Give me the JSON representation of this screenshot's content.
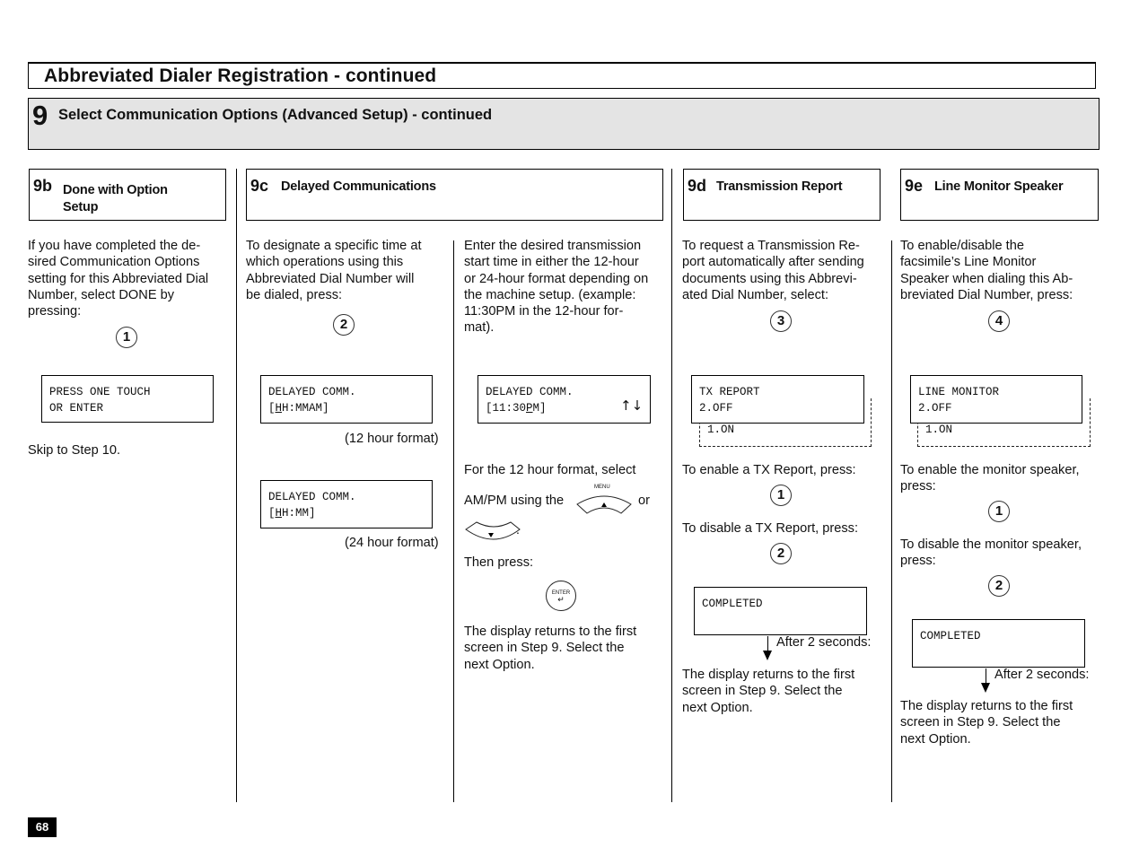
{
  "page_title": "Abbreviated Dialer Registration - continued",
  "step": {
    "number": "9",
    "title": "Select Communication Options (Advanced Setup) - continued"
  },
  "sections": {
    "s9b": {
      "num": "9b",
      "title_line1": "Done with Option",
      "title_line2": "Setup",
      "body": [
        "If you have completed the de-",
        "sired Communication Options",
        "setting for this Abbreviated Dial",
        "Number, select DONE by",
        "pressing:"
      ],
      "key": "1",
      "lcd": [
        "PRESS ONE TOUCH",
        "OR ENTER"
      ],
      "after": "Skip to Step 10."
    },
    "s9c": {
      "num": "9c",
      "title": "Delayed Communications",
      "body": [
        "To designate a specific time at",
        "which operations using this",
        "Abbreviated Dial Number will",
        "be dialed, press:"
      ],
      "key": "2",
      "lcd12": {
        "line1": "DELAYED COMM.",
        "line2_pre": "[",
        "line2_u": "H",
        "line2_post": "H:MMAM]"
      },
      "caption12": "(12 hour format)",
      "lcd24": {
        "line1": "DELAYED COMM.",
        "line2_pre": "[",
        "line2_u": "H",
        "line2_post": "H:MM]"
      },
      "caption24": "(24 hour format)",
      "body2": [
        "Enter the desired transmission",
        "start time in either the 12-hour",
        "or 24-hour format depending on",
        "the machine setup. (example:",
        "11:30PM in the 12-hour for-",
        "mat)."
      ],
      "lcd_example": {
        "line1": "DELAYED COMM.",
        "line2_pre": "[11:30",
        "line2_u": "P",
        "line2_post": "M]",
        "arrows": "↑↓"
      },
      "ampm_line1": "For the 12 hour format, select",
      "ampm_line2_pre": "AM/PM using the",
      "ampm_or": "or",
      "menu_label": "MENU",
      "then_press": "Then press:",
      "enter_label": "ENTER",
      "returns": [
        "The display returns to the first",
        "screen in Step 9. Select the",
        "next Option."
      ]
    },
    "s9d": {
      "num": "9d",
      "title": "Transmission Report",
      "body": [
        "To request a Transmission Re-",
        "port automatically after sending",
        "documents using this Abbrevi-",
        "ated Dial Number, select:"
      ],
      "key": "3",
      "lcd": [
        "TX REPORT",
        "2.OFF"
      ],
      "alt_option": "1.ON",
      "enable_text": "To enable a TX Report, press:",
      "enable_key": "1",
      "disable_text": "To disable a TX Report, press:",
      "disable_key": "2",
      "completed": "COMPLETED",
      "after": "After 2 seconds:",
      "returns": [
        "The display returns to the first",
        "screen in Step 9. Select the",
        "next Option."
      ]
    },
    "s9e": {
      "num": "9e",
      "title": "Line Monitor Speaker",
      "body": [
        "To enable/disable the",
        "facsimile’s Line Monitor",
        "Speaker when dialing this Ab-",
        "breviated Dial Number, press:"
      ],
      "key": "4",
      "lcd": [
        "LINE MONITOR",
        "2.OFF"
      ],
      "alt_option": "1.ON",
      "enable_text": [
        "To enable the monitor speaker,",
        "press:"
      ],
      "enable_key": "1",
      "disable_text": [
        "To disable the monitor speaker,",
        "press:"
      ],
      "disable_key": "2",
      "completed": "COMPLETED",
      "after": "After 2 seconds:",
      "returns": [
        "The display returns to the first",
        "screen in Step 9. Select the",
        "next Option."
      ]
    }
  },
  "page_number": "68"
}
